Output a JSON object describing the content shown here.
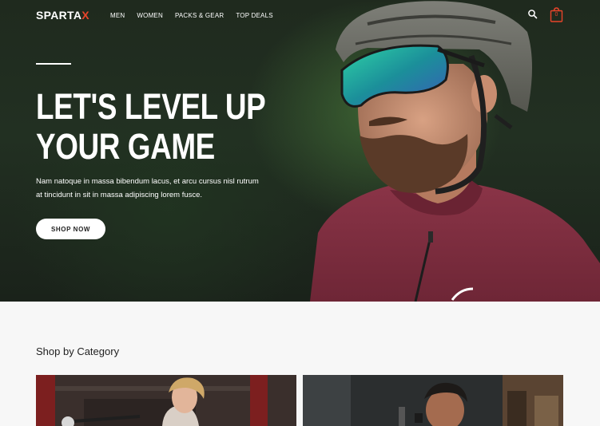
{
  "brand": {
    "name_main": "SPARTA",
    "name_accent": "X"
  },
  "nav": {
    "items": [
      {
        "label": "MEN"
      },
      {
        "label": "WOMEN"
      },
      {
        "label": "PACKS & GEAR"
      },
      {
        "label": "TOP DEALS"
      }
    ],
    "cart_count": "0",
    "icons": {
      "search": "search-icon",
      "cart": "shopping-bag-icon"
    }
  },
  "hero": {
    "title_line1": "LET'S LEVEL UP",
    "title_line2": "YOUR GAME",
    "description": "Nam natoque in massa bibendum lacus, et arcu cursus nisl rutrum at tincidunt in sit in massa adipiscing lorem fusce.",
    "cta_label": "SHOP NOW"
  },
  "categories": {
    "heading": "Shop by Category"
  },
  "colors": {
    "accent": "#e8442a",
    "hero_bg": "#1f2a1e",
    "jersey": "#7a2b3e",
    "page_bg": "#f7f7f7"
  }
}
